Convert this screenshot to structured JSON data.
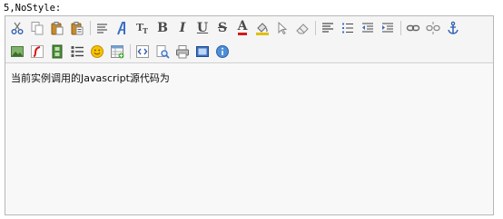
{
  "caption": "5,NoStyle:",
  "editor": {
    "content": "当前实例调用的Javascript源代码为"
  },
  "toolbar": {
    "bold_glyph": "B",
    "italic_glyph": "I",
    "underline_glyph": "U",
    "strike_glyph": "S",
    "fontcolor_glyph": "A"
  }
}
